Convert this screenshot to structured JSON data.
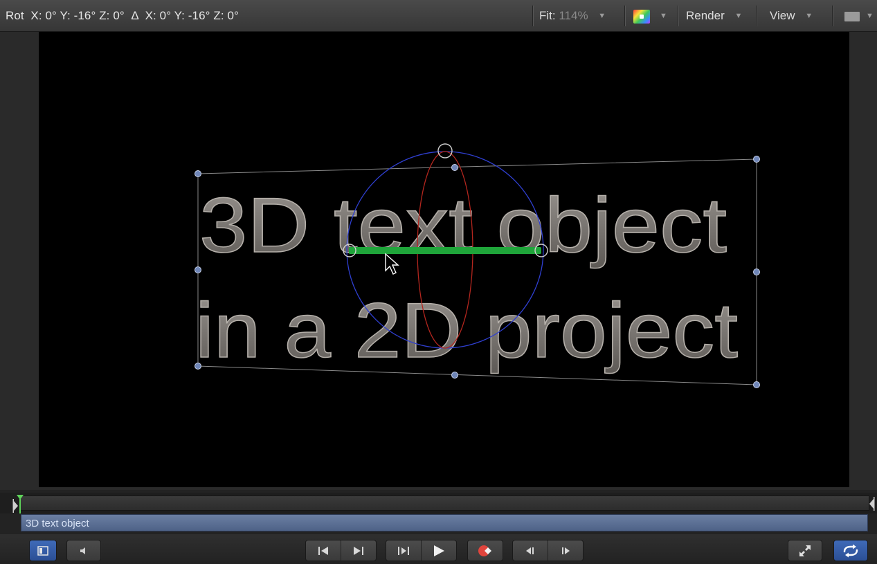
{
  "hud": {
    "readout": "Rot  X: 0° Y: -16° Z: 0°  Δ  X: 0° Y: -16° Z: 0°"
  },
  "toolbar": {
    "fit_label": "Fit:",
    "fit_value": "114%",
    "render_label": "Render",
    "view_label": "View",
    "dropdown_arrow": "▼"
  },
  "canvas": {
    "text_line1": "3D text object",
    "text_line2": "in a 2D project",
    "colors": {
      "text_fill": "#7a7672",
      "bounding_box": "#8a8a8a",
      "handle": "#6f86b8",
      "rotation_ring": "#2f3fd0",
      "y_axis_ring": "#b3261e",
      "x_axis_bar": "#1fa53a"
    }
  },
  "timeline": {
    "track_label": "3D text object",
    "track_color": "#5a6d93"
  },
  "transport": {
    "icons": [
      "toggle-panel-icon",
      "mute-icon",
      "go-to-start-icon",
      "go-to-end-icon",
      "play-from-start-icon",
      "play-icon",
      "record-icon",
      "prev-frame-icon",
      "next-frame-icon",
      "fullscreen-icon",
      "loop-icon"
    ]
  }
}
